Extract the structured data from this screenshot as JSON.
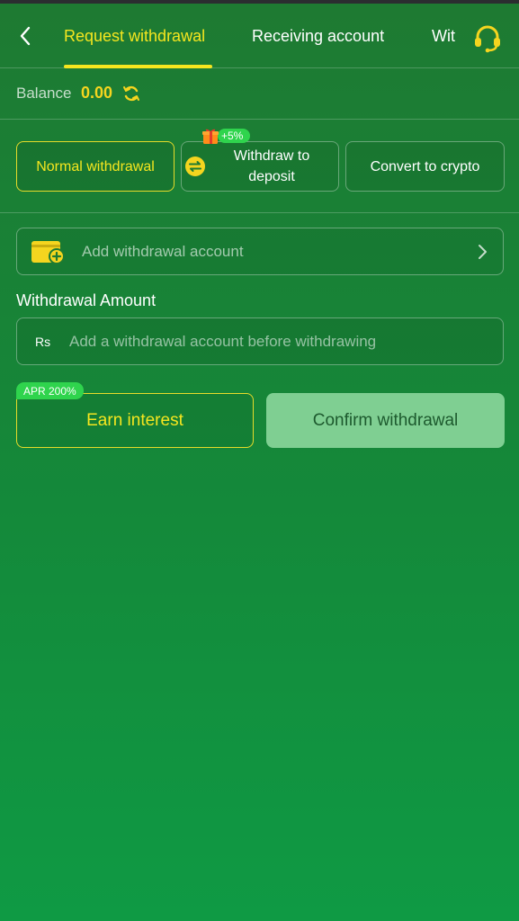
{
  "header": {
    "tabs": [
      {
        "label": "Request withdrawal",
        "active": true
      },
      {
        "label": "Receiving account",
        "active": false
      },
      {
        "label": "Wit",
        "active": false
      }
    ],
    "back_icon": "chevron-left-icon",
    "support_icon": "headset-icon"
  },
  "balance": {
    "label": "Balance",
    "value": "0.00",
    "icon": "refresh-icon"
  },
  "methods": {
    "items": [
      {
        "label": "Normal withdrawal",
        "active": true
      },
      {
        "label": "Withdraw to deposit",
        "active": false
      },
      {
        "label": "Convert to crypto",
        "active": false
      }
    ],
    "bonus_badge": "+5%"
  },
  "account": {
    "label": "Add withdrawal account",
    "icon": "wallet-add-icon"
  },
  "amount": {
    "label": "Withdrawal Amount",
    "currency": "Rs",
    "placeholder": "Add a withdrawal account before withdrawing"
  },
  "actions": {
    "apr_badge": "APR 200%",
    "earn_label": "Earn interest",
    "confirm_label": "Confirm withdrawal"
  },
  "colors": {
    "accent": "#f5e61f",
    "badge_green": "#2fd44d",
    "confirm_bg": "#7fcf92"
  }
}
